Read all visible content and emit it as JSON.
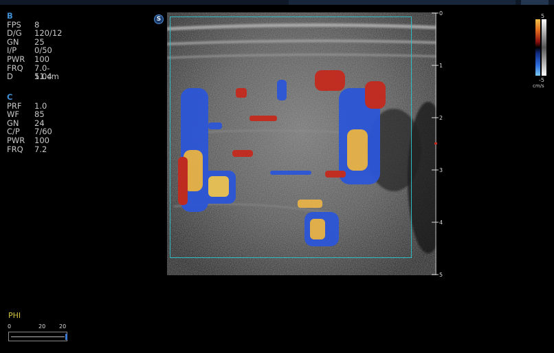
{
  "b_mode": {
    "header": "B",
    "params": [
      {
        "key": "FPS",
        "value": "8"
      },
      {
        "key": "D/G",
        "value": "120/12"
      },
      {
        "key": "GN",
        "value": "25"
      },
      {
        "key": "I/P",
        "value": "0/50"
      },
      {
        "key": "PWR",
        "value": "100"
      },
      {
        "key": "FRQ",
        "value": "7.0-11.4"
      },
      {
        "key": "D",
        "value": "5.0cm"
      }
    ]
  },
  "c_mode": {
    "header": "C",
    "params": [
      {
        "key": "PRF",
        "value": "1.0"
      },
      {
        "key": "WF",
        "value": "85"
      },
      {
        "key": "GN",
        "value": "24"
      },
      {
        "key": "C/P",
        "value": "7/60"
      },
      {
        "key": "PWR",
        "value": "100"
      },
      {
        "key": "FRQ",
        "value": "7.2"
      }
    ]
  },
  "probe_marker": "S",
  "depth_scale": {
    "ticks": [
      "0",
      "1",
      "2",
      "3",
      "4",
      "5"
    ],
    "max": 5
  },
  "color_scale": {
    "top": "5",
    "bottom": "-5",
    "unit": "cm/s",
    "colors": {
      "positive": "#d0241c",
      "negative": "#2f6fe0",
      "high": "#f3c24a"
    }
  },
  "phi": {
    "label": "PHI",
    "scale_labels": [
      "0",
      "20",
      "20"
    ],
    "level": 1.0
  },
  "colors": {
    "roi": "#34bcc4",
    "accent": "#3f8fd4",
    "phi": "#d7c640"
  }
}
